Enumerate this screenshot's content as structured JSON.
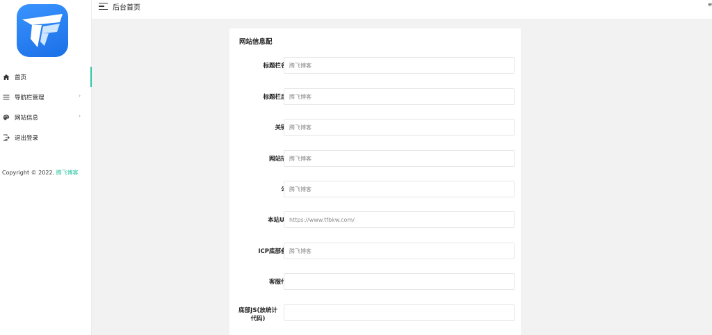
{
  "header": {
    "title": "后台首页",
    "right_cut": "e"
  },
  "sidebar": {
    "items": [
      {
        "label": "首页",
        "icon": "home-icon",
        "has_arrow": false,
        "active": true
      },
      {
        "label": "导航栏管理",
        "icon": "list-icon",
        "has_arrow": true,
        "active": false
      },
      {
        "label": "网站信息",
        "icon": "palette-icon",
        "has_arrow": true,
        "active": false
      },
      {
        "label": "退出登录",
        "icon": "logout-icon",
        "has_arrow": false,
        "active": false
      }
    ],
    "arrow_glyph": "›",
    "copyright_prefix": "Copyright © 2022.",
    "copyright_brand": "腾飞博客"
  },
  "form": {
    "title": "网站信息配",
    "fields": [
      {
        "label": "标题栏名称",
        "placeholder": "腾飞博客",
        "value": ""
      },
      {
        "label": "标题栏后缀",
        "placeholder": "腾飞博客",
        "value": ""
      },
      {
        "label": "关键字",
        "placeholder": "腾飞博客",
        "value": ""
      },
      {
        "label": "网站描述",
        "placeholder": "腾飞博客",
        "value": ""
      },
      {
        "label": "公告",
        "placeholder": "腾飞博客",
        "value": ""
      },
      {
        "label": "本站URL",
        "placeholder": "https://www.tfbkw.com/",
        "value": ""
      },
      {
        "label": "ICP底部备案",
        "placeholder": "腾飞博客",
        "value": ""
      },
      {
        "label": "客服代码",
        "placeholder": "",
        "value": ""
      },
      {
        "label": "底部JS(放统计代码)",
        "placeholder": "",
        "value": ""
      }
    ]
  },
  "colors": {
    "accent": "#2ec7a5",
    "logo_blue": "#1a6fe6",
    "background": "#f2f2f2"
  }
}
